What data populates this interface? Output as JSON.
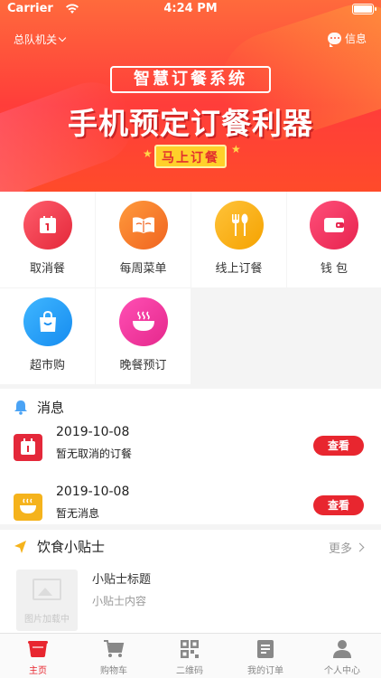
{
  "status_bar": {
    "carrier": "Carrier",
    "time": "4:24 PM"
  },
  "header": {
    "location": "总队机关",
    "messages_label": "信息"
  },
  "banner": {
    "subtitle": "智慧订餐系统",
    "title": "手机预定订餐利器",
    "cta": "马上订餐"
  },
  "menu": {
    "items": [
      {
        "label": "取消餐",
        "icon": "calendar-icon"
      },
      {
        "label": "每周菜单",
        "icon": "book-icon"
      },
      {
        "label": "线上订餐",
        "icon": "fork-spoon-icon"
      },
      {
        "label": "钱 包",
        "icon": "wallet-icon"
      },
      {
        "label": "超市购",
        "icon": "shopping-bag-icon"
      },
      {
        "label": "晚餐预订",
        "icon": "bowl-icon"
      }
    ]
  },
  "messages": {
    "title": "消息",
    "items": [
      {
        "date": "2019-10-08",
        "text": "暂无取消的订餐",
        "button": "查看",
        "icon": "calendar-icon"
      },
      {
        "date": "2019-10-08",
        "text": "暂无消息",
        "button": "查看",
        "icon": "bowl-icon"
      }
    ]
  },
  "tips": {
    "title": "饮食小贴士",
    "more": "更多",
    "item": {
      "image_placeholder": "图片加载中",
      "title": "小贴士标题",
      "content": "小贴士内容"
    }
  },
  "tabbar": {
    "tabs": [
      {
        "label": "主页",
        "icon": "home-icon",
        "active": true
      },
      {
        "label": "购物车",
        "icon": "cart-icon"
      },
      {
        "label": "二维码",
        "icon": "qrcode-icon"
      },
      {
        "label": "我的订单",
        "icon": "order-icon"
      },
      {
        "label": "个人中心",
        "icon": "user-icon"
      }
    ]
  },
  "colors": {
    "accent": "#e8262f",
    "banner_start": "#ff6a3c",
    "banner_end": "#ff3d3a"
  }
}
